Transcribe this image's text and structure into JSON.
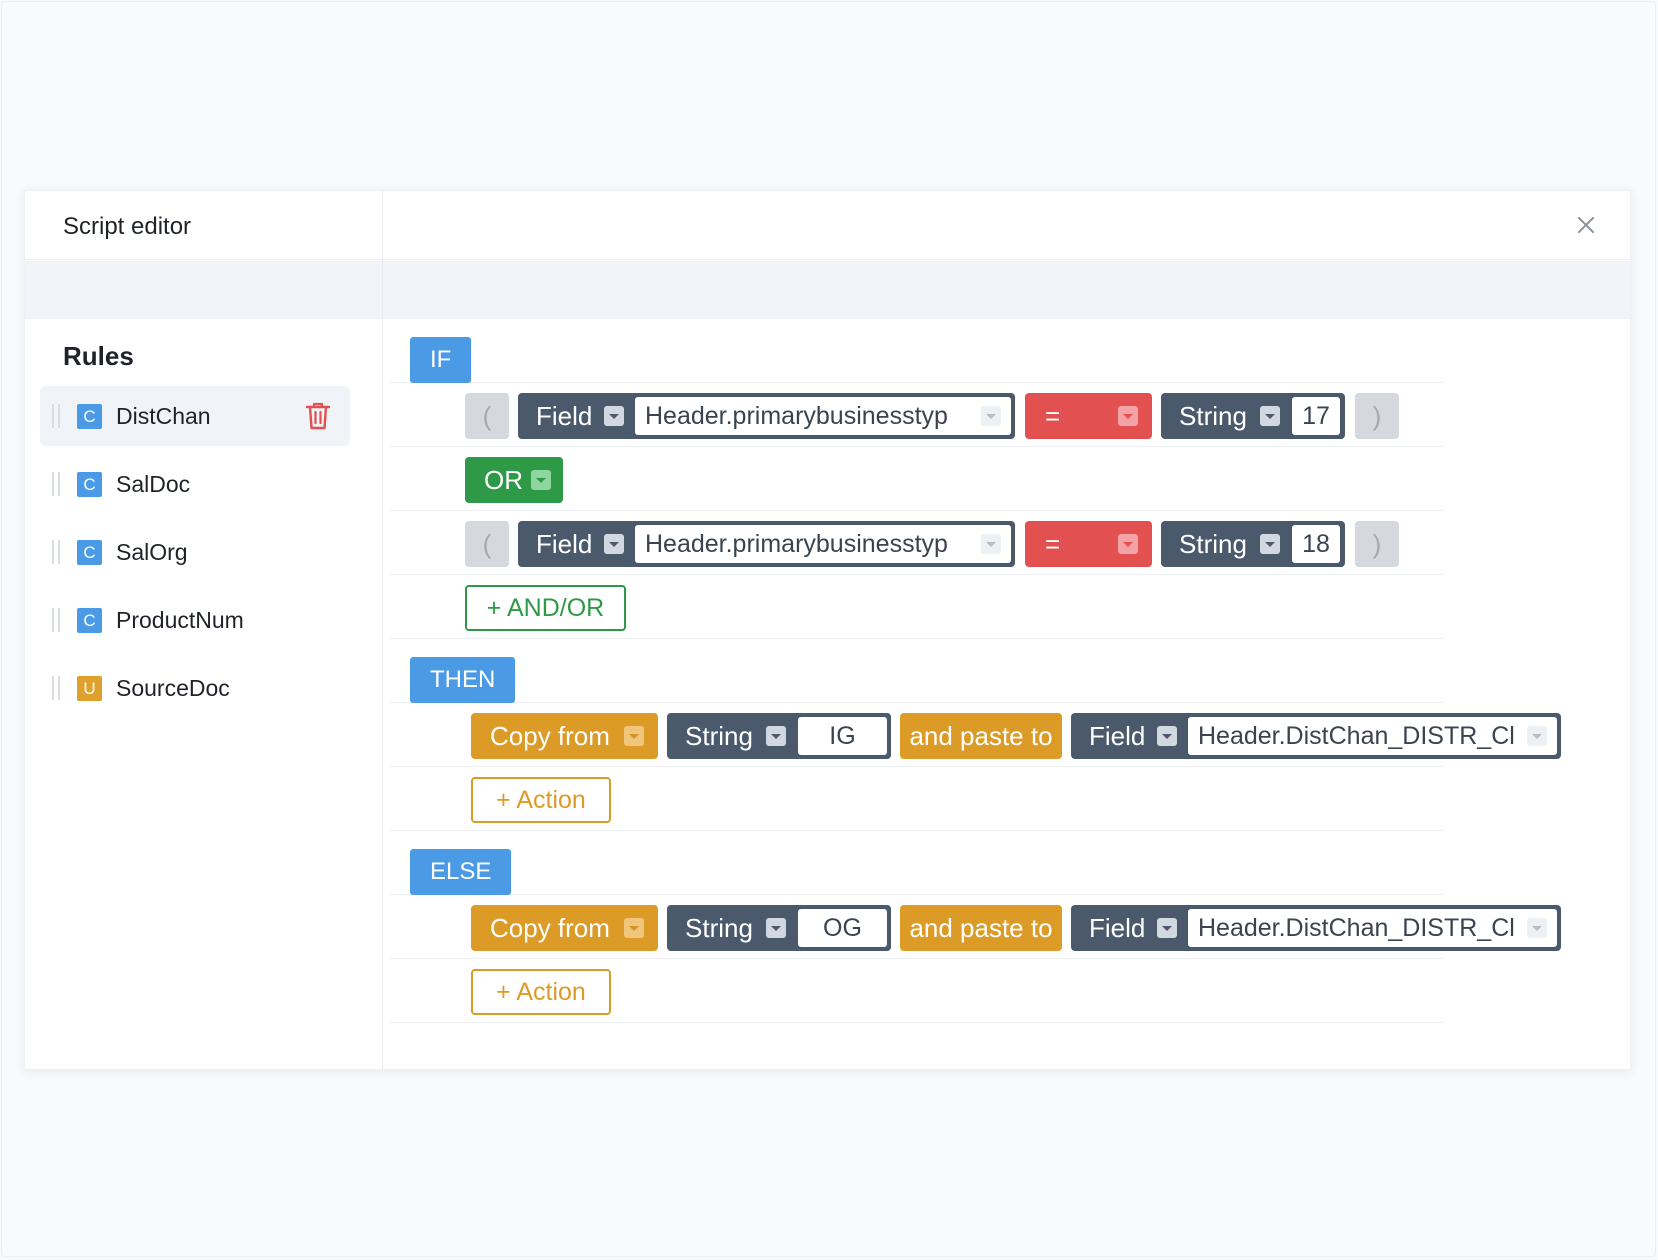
{
  "window": {
    "title": "Script editor"
  },
  "sidebar": {
    "title": "Rules",
    "items": [
      {
        "badge": "C",
        "name": "DistChan",
        "active": true
      },
      {
        "badge": "C",
        "name": "SalDoc"
      },
      {
        "badge": "C",
        "name": "SalOrg"
      },
      {
        "badge": "C",
        "name": "ProductNum"
      },
      {
        "badge": "U",
        "name": "SourceDoc"
      }
    ]
  },
  "editor": {
    "if_label": "IF",
    "then_label": "THEN",
    "else_label": "ELSE",
    "paren_open": "(",
    "paren_close": ")",
    "conditions": [
      {
        "left_type": "Field",
        "left_value": "Header.primarybusinesstyp",
        "operator": "=",
        "right_type": "String",
        "right_value": "17"
      },
      {
        "left_type": "Field",
        "left_value": "Header.primarybusinesstyp",
        "operator": "=",
        "right_type": "String",
        "right_value": "18"
      }
    ],
    "connector": "OR",
    "add_and_or": "+ AND/OR",
    "then_action": {
      "copy": "Copy from",
      "source_type": "String",
      "source_value": "IG",
      "paste": "and paste to",
      "target_type": "Field",
      "target_value": "Header.DistChan_DISTR_Cl"
    },
    "else_action": {
      "copy": "Copy from",
      "source_type": "String",
      "source_value": "OG",
      "paste": "and paste to",
      "target_type": "Field",
      "target_value": "Header.DistChan_DISTR_Cl"
    },
    "add_action": "+ Action"
  },
  "colors": {
    "blue": "#4a9ae6",
    "dark": "#4a5a6c",
    "red": "#e2504f",
    "green": "#2e9a47",
    "orange": "#dc9a26"
  }
}
